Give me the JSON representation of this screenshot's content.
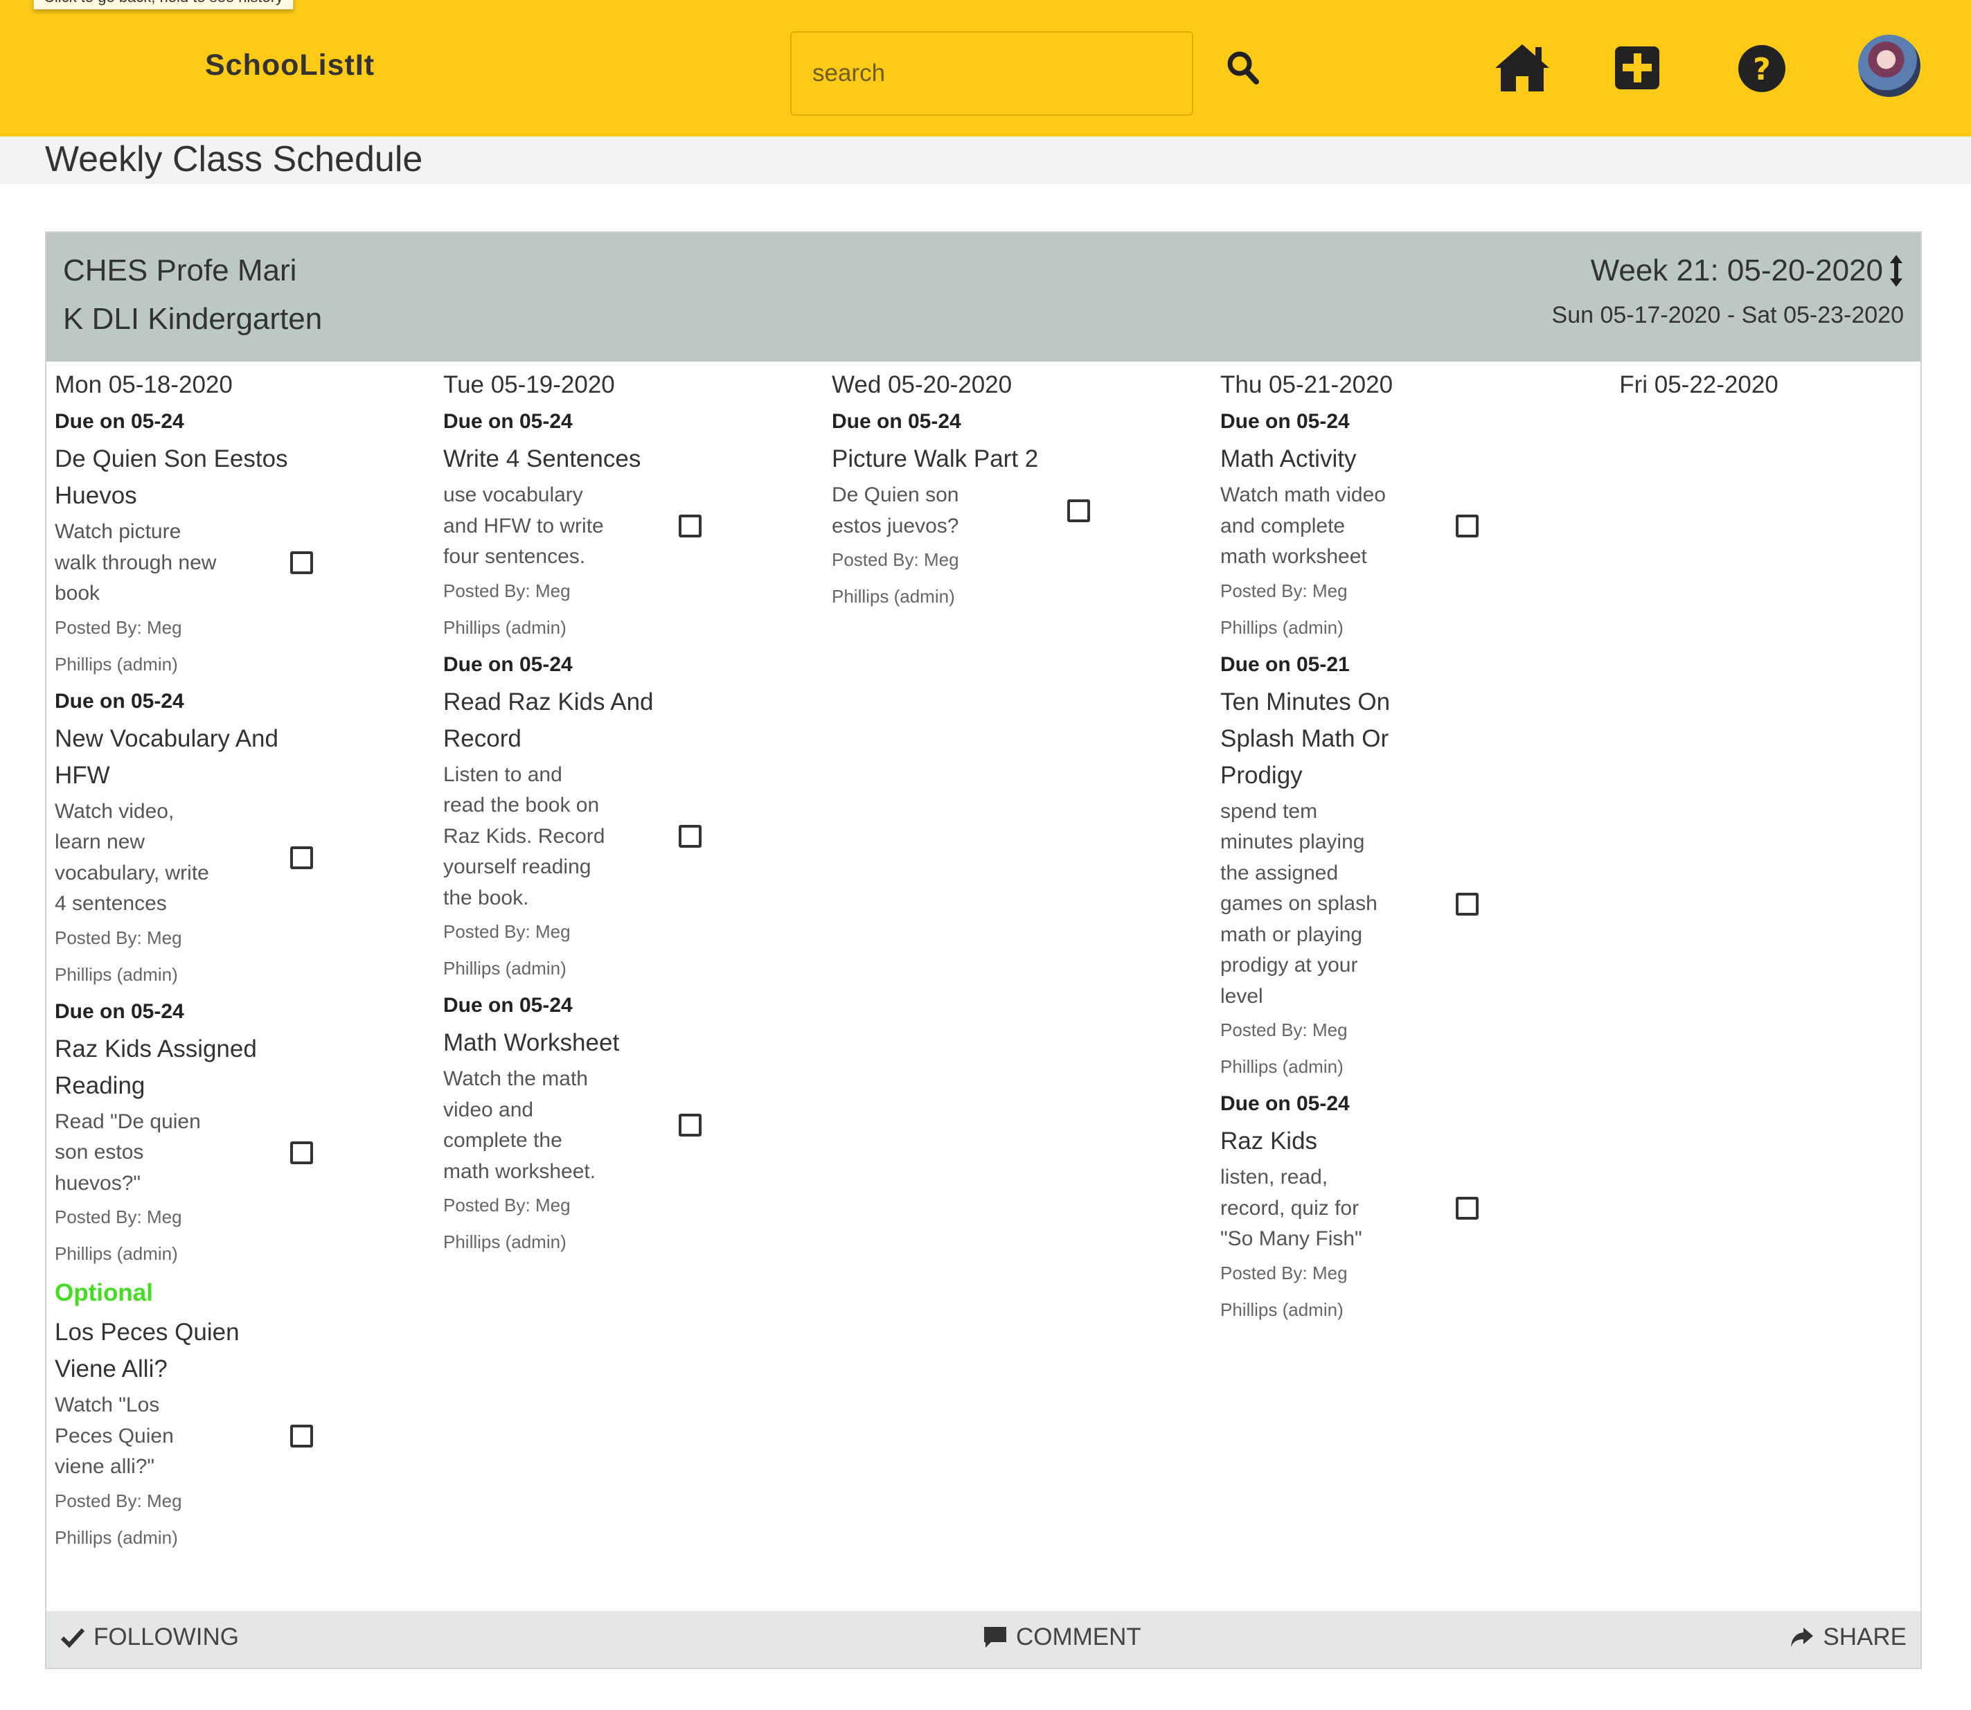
{
  "tooltip": "Click to go back, hold to see history",
  "header": {
    "brand": "SchooListIt",
    "search_placeholder": "search",
    "icons": [
      "search-icon",
      "home-icon",
      "plus-icon",
      "help-icon",
      "avatar"
    ]
  },
  "page_title": "Weekly Class Schedule",
  "card": {
    "school": "CHES Profe Mari",
    "class_name": "K DLI Kindergarten",
    "week": "Week 21: 05-20-2020",
    "range": "Sun 05-17-2020 - Sat 05-23-2020"
  },
  "days": [
    {
      "date": "Mon 05-18-2020",
      "tasks": [
        {
          "due": "Due on 05-24",
          "title": "De Quien Son Eestos Huevos",
          "desc": "Watch picture walk through new book",
          "posted": "Posted By: Meg Phillips (admin)"
        },
        {
          "due": "Due on 05-24",
          "title": "New Vocabulary And HFW",
          "desc": "Watch video, learn new vocabulary, write 4 sentences",
          "posted": "Posted By: Meg Phillips (admin)"
        },
        {
          "due": "Due on 05-24",
          "title": "Raz Kids Assigned Reading",
          "desc": "Read \"De quien son estos huevos?\"",
          "posted": "Posted By: Meg Phillips (admin)"
        },
        {
          "due": "Optional",
          "title": "Los Peces Quien Viene Alli?",
          "desc": "Watch \"Los Peces Quien viene alli?\"",
          "posted": "Posted By: Meg Phillips (admin)"
        }
      ]
    },
    {
      "date": "Tue 05-19-2020",
      "tasks": [
        {
          "due": "Due on 05-24",
          "title": "Write 4 Sentences",
          "desc": "use vocabulary and HFW to write four sentences.",
          "posted": "Posted By: Meg Phillips (admin)"
        },
        {
          "due": "Due on 05-24",
          "title": "Read Raz Kids And Record",
          "desc": "Listen to and read the book on Raz Kids. Record yourself reading the book.",
          "posted": "Posted By: Meg Phillips (admin)"
        },
        {
          "due": "Due on 05-24",
          "title": "Math Worksheet",
          "desc": "Watch the math video and complete the math worksheet.",
          "posted": "Posted By: Meg Phillips (admin)"
        }
      ]
    },
    {
      "date": "Wed 05-20-2020",
      "tasks": [
        {
          "due": "Due on 05-24",
          "title": "Picture Walk Part 2",
          "desc": "De Quien son estos juevos?",
          "posted": "Posted By: Meg Phillips (admin)"
        }
      ]
    },
    {
      "date": "Thu 05-21-2020",
      "tasks": [
        {
          "due": "Due on 05-24",
          "title": "Math Activity",
          "desc": "Watch math video and complete math worksheet",
          "posted": "Posted By: Meg Phillips (admin)"
        },
        {
          "due": "Due on 05-21",
          "title": "Ten Minutes On Splash Math Or Prodigy",
          "desc": "spend tem minutes playing the assigned games on splash math or playing prodigy at your level",
          "posted": "Posted By: Meg Phillips (admin)"
        },
        {
          "due": "Due on 05-24",
          "title": "Raz Kids",
          "desc": "listen, read, record, quiz for \"So Many Fish\"",
          "posted": "Posted By: Meg Phillips (admin)"
        }
      ]
    },
    {
      "date": "Fri 05-22-2020",
      "tasks": []
    }
  ],
  "footer": {
    "following": "FOLLOWING",
    "comment": "COMMENT",
    "share": "SHARE"
  }
}
